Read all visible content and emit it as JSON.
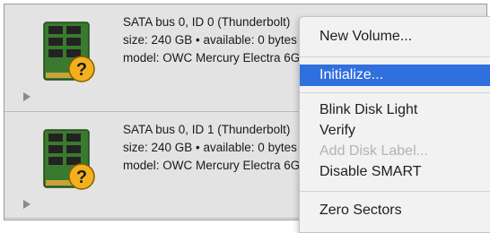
{
  "disks": [
    {
      "bus": "SATA bus 0, ID 0 (Thunderbolt)",
      "size": "size: 240 GB • available: 0 bytes",
      "model": "model: OWC Mercury Electra 6G"
    },
    {
      "bus": "SATA bus 0, ID 1 (Thunderbolt)",
      "size": "size: 240 GB • available: 0 bytes",
      "model": "model: OWC Mercury Electra 6G"
    }
  ],
  "disk_icon": "ssd-question-icon",
  "expand_icon": "disclosure-triangle-icon",
  "menu": {
    "items": [
      {
        "label": "New Volume...",
        "state": "normal"
      },
      {
        "label": "Initialize...",
        "state": "highlighted"
      },
      {
        "label": "Blink Disk Light",
        "state": "normal"
      },
      {
        "label": "Verify",
        "state": "normal"
      },
      {
        "label": "Add Disk Label...",
        "state": "disabled"
      },
      {
        "label": "Disable SMART",
        "state": "normal"
      },
      {
        "label": "Zero Sectors",
        "state": "normal"
      }
    ],
    "highlight_color": "#2f6fde"
  }
}
